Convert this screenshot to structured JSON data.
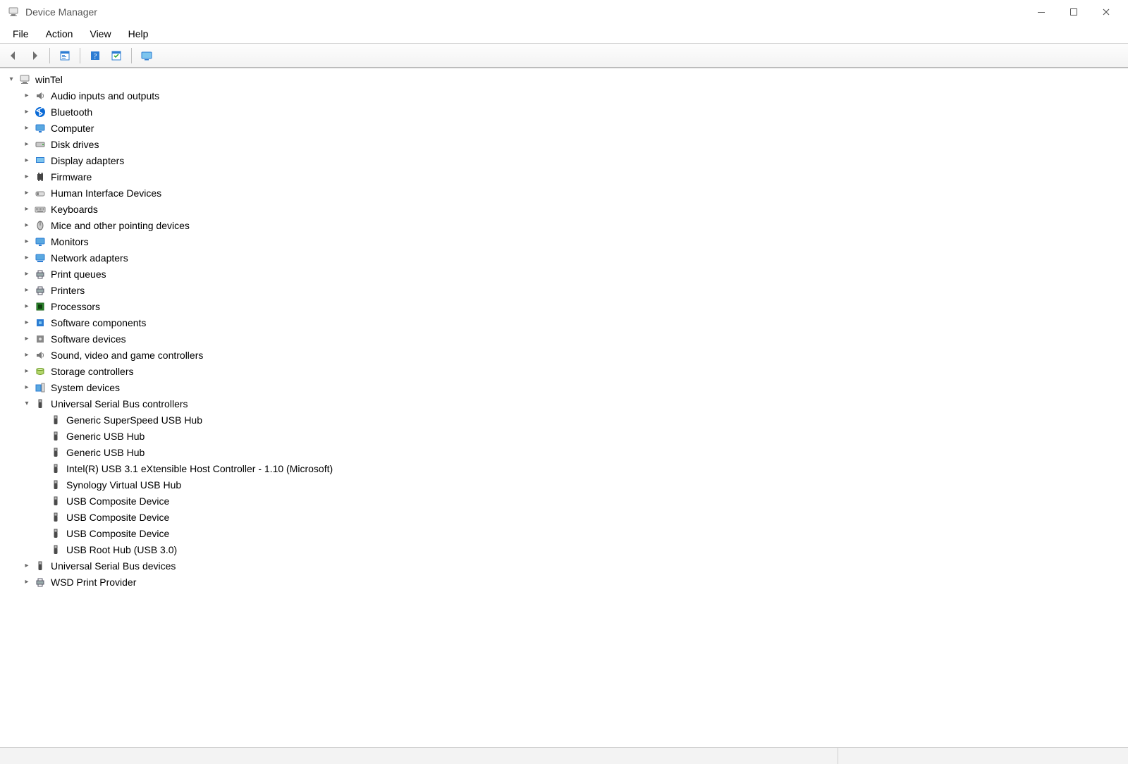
{
  "window": {
    "title": "Device Manager"
  },
  "menubar": [
    "File",
    "Action",
    "View",
    "Help"
  ],
  "toolbar": {
    "back": "Back",
    "forward": "Forward",
    "properties": "Properties",
    "help": "Help",
    "scan": "Scan for hardware changes",
    "show": "Show hidden devices"
  },
  "tree": {
    "root": {
      "label": "winTel",
      "icon": "computer",
      "expanded": true
    },
    "categories": [
      {
        "label": "Audio inputs and outputs",
        "icon": "audio",
        "expanded": false
      },
      {
        "label": "Bluetooth",
        "icon": "bluetooth",
        "expanded": false
      },
      {
        "label": "Computer",
        "icon": "monitor",
        "expanded": false
      },
      {
        "label": "Disk drives",
        "icon": "disk",
        "expanded": false
      },
      {
        "label": "Display adapters",
        "icon": "display",
        "expanded": false
      },
      {
        "label": "Firmware",
        "icon": "chip",
        "expanded": false
      },
      {
        "label": "Human Interface Devices",
        "icon": "hid",
        "expanded": false
      },
      {
        "label": "Keyboards",
        "icon": "keyboard",
        "expanded": false
      },
      {
        "label": "Mice and other pointing devices",
        "icon": "mouse",
        "expanded": false
      },
      {
        "label": "Monitors",
        "icon": "monitor",
        "expanded": false
      },
      {
        "label": "Network adapters",
        "icon": "network",
        "expanded": false
      },
      {
        "label": "Print queues",
        "icon": "printer",
        "expanded": false
      },
      {
        "label": "Printers",
        "icon": "printer",
        "expanded": false
      },
      {
        "label": "Processors",
        "icon": "cpu",
        "expanded": false
      },
      {
        "label": "Software components",
        "icon": "component",
        "expanded": false
      },
      {
        "label": "Software devices",
        "icon": "softdev",
        "expanded": false
      },
      {
        "label": "Sound, video and game controllers",
        "icon": "audio",
        "expanded": false
      },
      {
        "label": "Storage controllers",
        "icon": "storage",
        "expanded": false
      },
      {
        "label": "System devices",
        "icon": "system",
        "expanded": false
      },
      {
        "label": "Universal Serial Bus controllers",
        "icon": "usb",
        "expanded": true,
        "children": [
          {
            "label": "Generic SuperSpeed USB Hub",
            "icon": "usb"
          },
          {
            "label": "Generic USB Hub",
            "icon": "usb"
          },
          {
            "label": "Generic USB Hub",
            "icon": "usb"
          },
          {
            "label": "Intel(R) USB 3.1 eXtensible Host Controller - 1.10 (Microsoft)",
            "icon": "usb"
          },
          {
            "label": "Synology Virtual USB Hub",
            "icon": "usb"
          },
          {
            "label": "USB Composite Device",
            "icon": "usb"
          },
          {
            "label": "USB Composite Device",
            "icon": "usb"
          },
          {
            "label": "USB Composite Device",
            "icon": "usb"
          },
          {
            "label": "USB Root Hub (USB 3.0)",
            "icon": "usb"
          }
        ]
      },
      {
        "label": "Universal Serial Bus devices",
        "icon": "usb",
        "expanded": false
      },
      {
        "label": "WSD Print Provider",
        "icon": "printer",
        "expanded": false
      }
    ]
  }
}
